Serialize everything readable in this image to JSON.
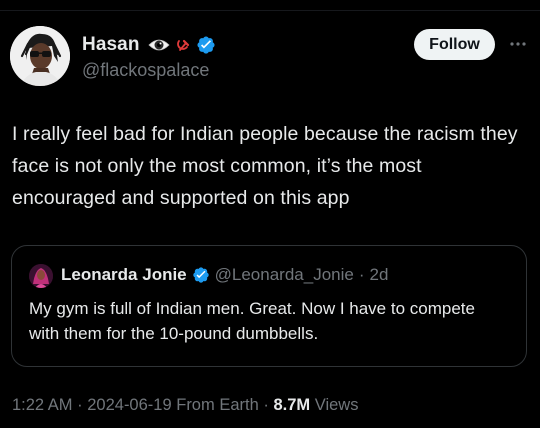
{
  "author": {
    "display_name": "Hasan",
    "handle": "@flackospalace",
    "badges": [
      "eye-emoji-icon",
      "hammer-sickle-icon",
      "verified-badge-icon"
    ],
    "verified_color": "#1d9bf0"
  },
  "follow_button": {
    "label": "Follow"
  },
  "more_button": {
    "icon": "more-horizontal-icon"
  },
  "tweet": {
    "text": "I really feel bad for Indian people because the racism they face is not only the most common, it’s the most encouraged and supported on this app"
  },
  "quote": {
    "display_name": "Leonarda Jonie",
    "handle": "@Leonarda_Jonie",
    "separator": "·",
    "time": "2d",
    "text": "My gym is full of Indian men. Great. Now I have to compete with them for the 10-pound dumbbells."
  },
  "meta": {
    "time": "1:22 AM",
    "sep1": "·",
    "date": "2024-06-19",
    "location": "From Earth",
    "sep2": "·",
    "views_count": "8.7M",
    "views_label": "Views"
  },
  "colors": {
    "background": "#000000",
    "text_primary": "#e7e9ea",
    "text_secondary": "#71767b",
    "border": "#2f3336",
    "follow_bg": "#eff3f4"
  }
}
